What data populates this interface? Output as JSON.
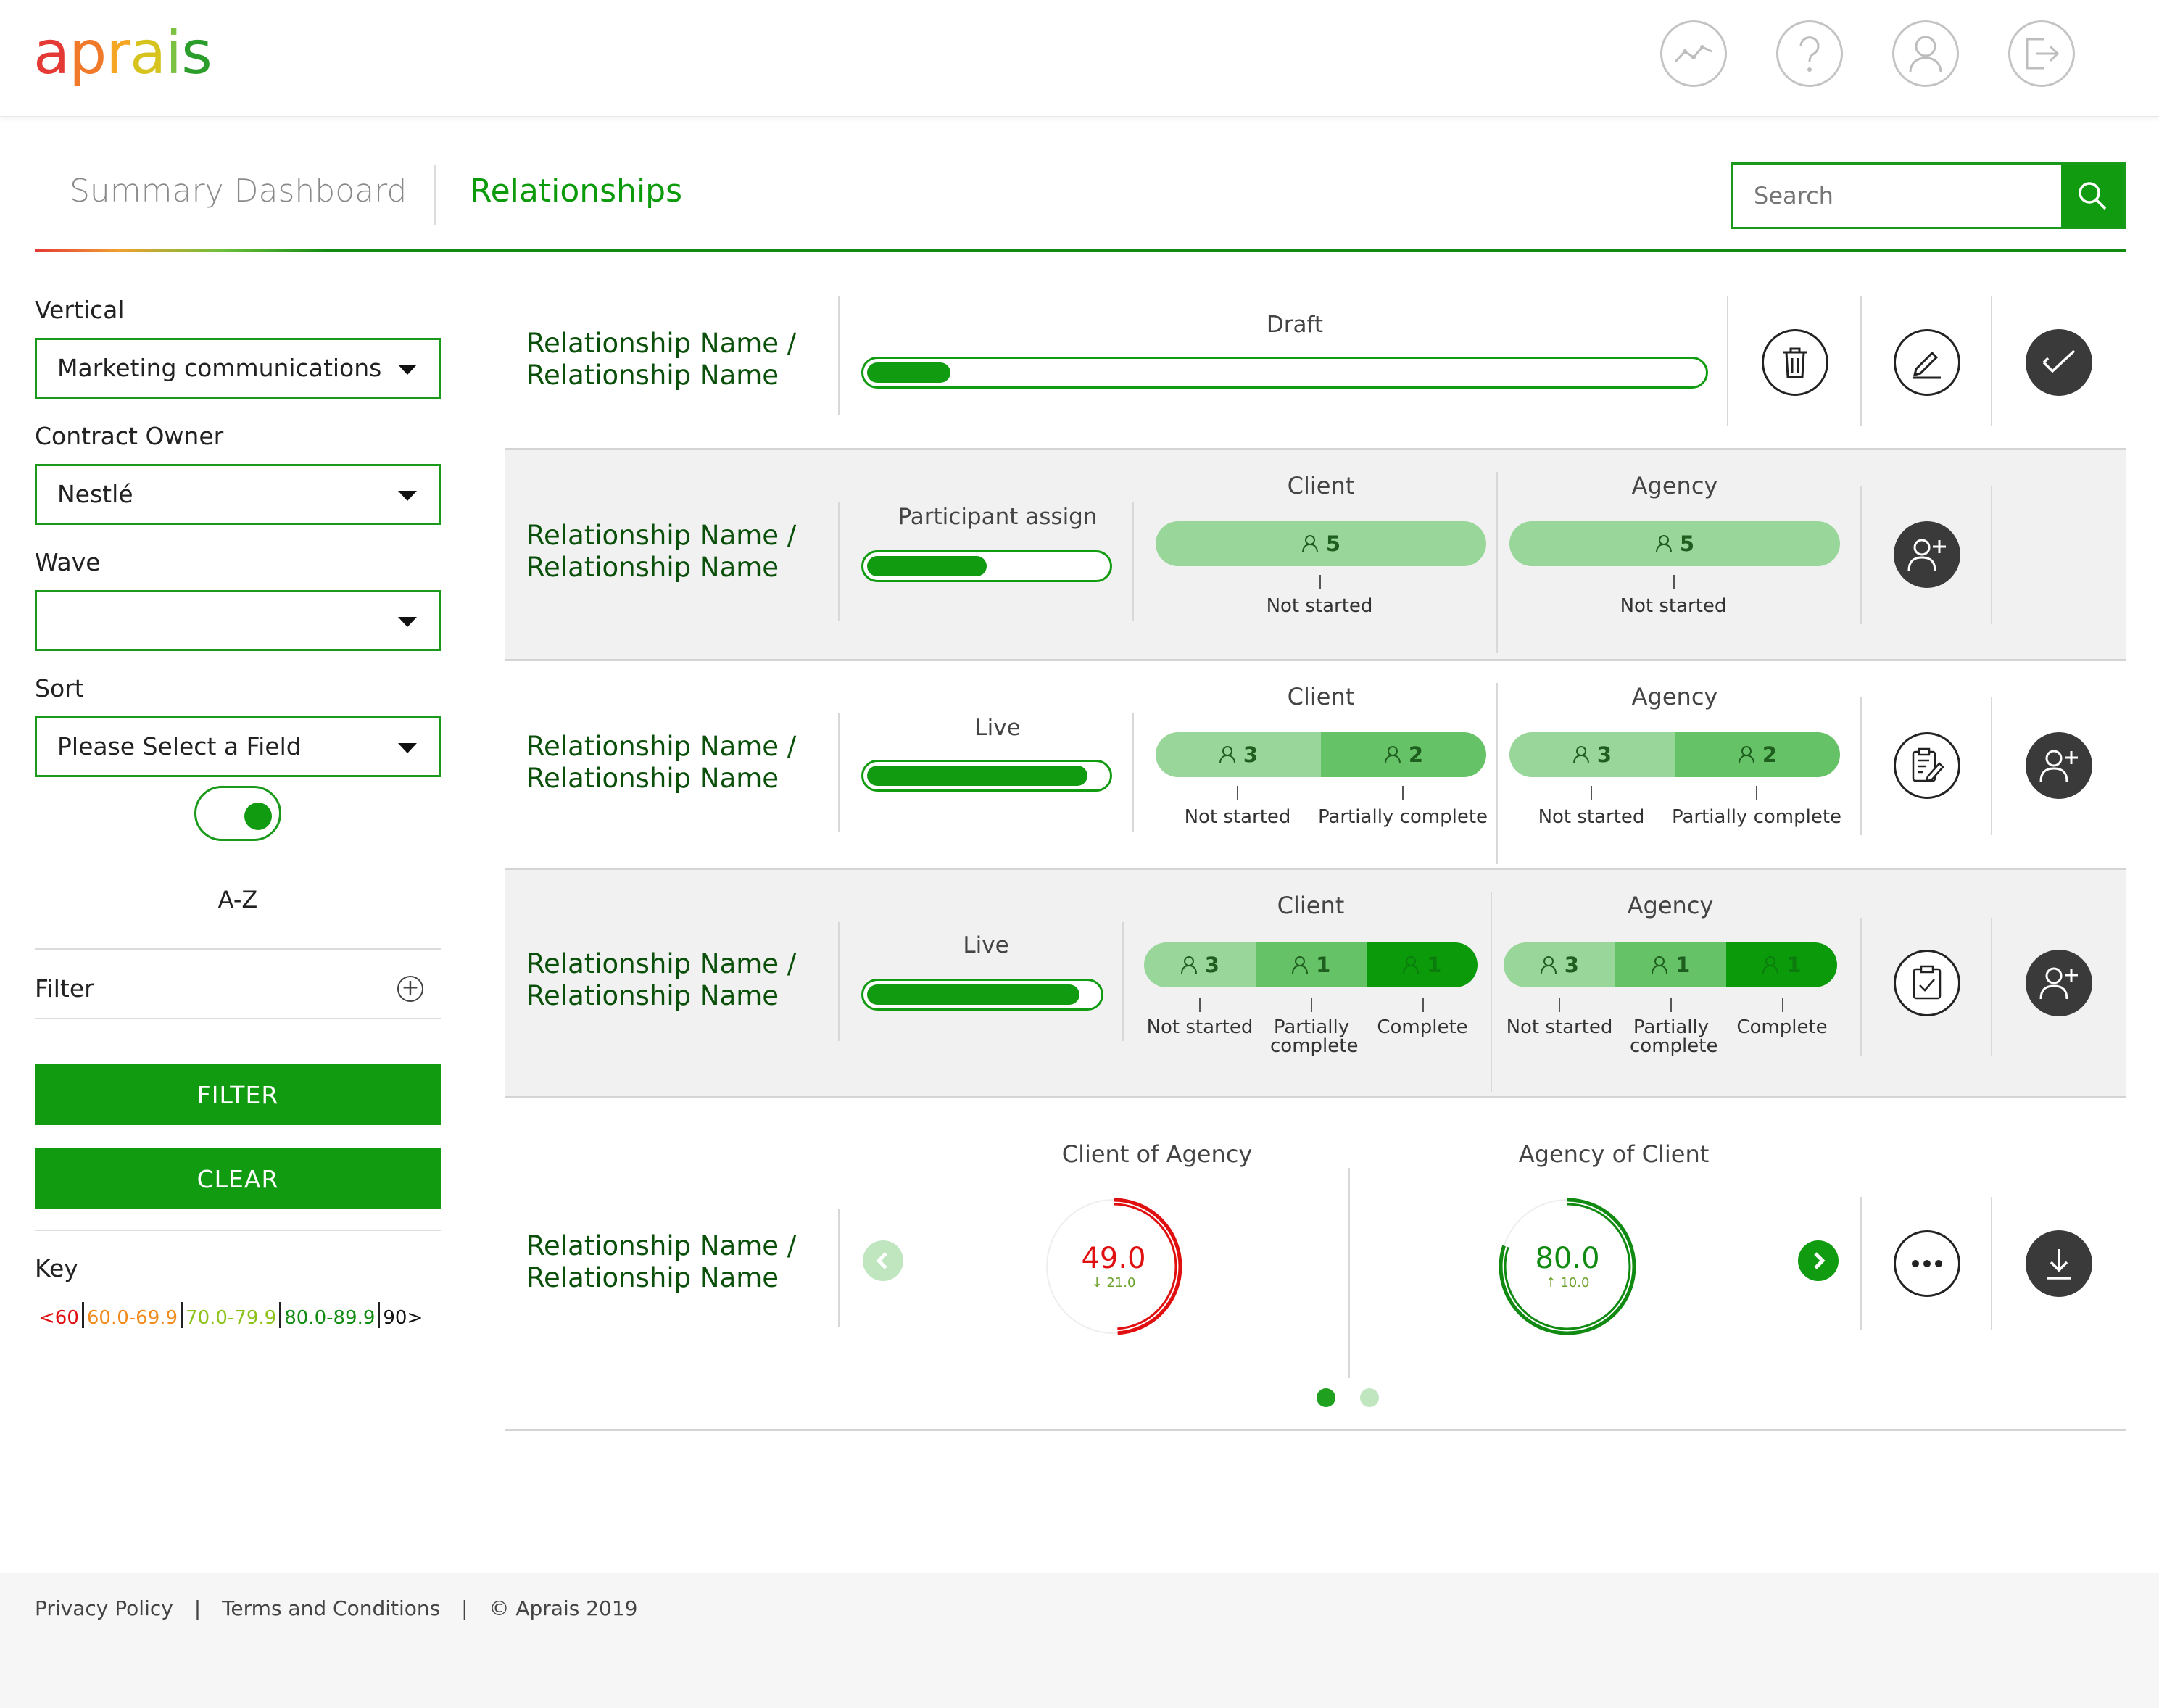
{
  "header": {
    "logo_letters": [
      {
        "ch": "a",
        "color": "#e53935"
      },
      {
        "ch": "p",
        "color": "#f07a2a"
      },
      {
        "ch": "r",
        "color": "#f5a623"
      },
      {
        "ch": "a",
        "color": "#d7c31e"
      },
      {
        "ch": "i",
        "color": "#7cc242"
      },
      {
        "ch": "s",
        "color": "#2a9d2a"
      }
    ],
    "icons": [
      "analytics-icon",
      "help-icon",
      "user-icon",
      "logout-icon"
    ]
  },
  "tabs": {
    "summary": "Summary Dashboard",
    "relationships": "Relationships"
  },
  "search": {
    "placeholder": "Search"
  },
  "sidebar": {
    "vertical_label": "Vertical",
    "vertical_value": "Marketing communications",
    "owner_label": "Contract Owner",
    "owner_value": "Nestlé",
    "wave_label": "Wave",
    "wave_value": "",
    "sort_label": "Sort",
    "sort_value": "Please Select a Field",
    "sort_order": "A-Z",
    "filter_label": "Filter",
    "filter_button": "FILTER",
    "clear_button": "CLEAR",
    "key_label": "Key",
    "key": [
      {
        "text": "<60",
        "color": "#e01010"
      },
      {
        "text": "60.0-69.9",
        "color": "#f08a1a"
      },
      {
        "text": "70.0-79.9",
        "color": "#8cc21a"
      },
      {
        "text": "80.0-89.9",
        "color": "#118a11"
      },
      {
        "text": "90>",
        "color": "#111111"
      }
    ]
  },
  "rows": [
    {
      "name_line1": "Relationship Name /",
      "name_line2": "Relationship Name",
      "status": "Draft",
      "progress": 0.1
    },
    {
      "name_line1": "Relationship Name /",
      "name_line2": "Relationship Name",
      "status": "Participant assign",
      "progress": 0.5,
      "client_title": "Client",
      "agency_title": "Agency",
      "client": [
        {
          "count": "5",
          "label": "Not started"
        }
      ],
      "agency": [
        {
          "count": "5",
          "label": "Not started"
        }
      ]
    },
    {
      "name_line1": "Relationship Name /",
      "name_line2": "Relationship Name",
      "status": "Live",
      "progress": 0.92,
      "client_title": "Client",
      "agency_title": "Agency",
      "client": [
        {
          "count": "3",
          "label": "Not started"
        },
        {
          "count": "2",
          "label": "Partially complete"
        }
      ],
      "agency": [
        {
          "count": "3",
          "label": "Not started"
        },
        {
          "count": "2",
          "label": "Partially complete"
        }
      ]
    },
    {
      "name_line1": "Relationship Name /",
      "name_line2": "Relationship Name",
      "status": "Live",
      "progress": 0.92,
      "client_title": "Client",
      "agency_title": "Agency",
      "client": [
        {
          "count": "3",
          "label": "Not started"
        },
        {
          "count": "1",
          "label": "Partially complete"
        },
        {
          "count": "1",
          "label": "Complete"
        }
      ],
      "agency": [
        {
          "count": "3",
          "label": "Not started"
        },
        {
          "count": "1",
          "label": "Partially complete"
        },
        {
          "count": "1",
          "label": "Complete"
        }
      ]
    },
    {
      "name_line1": "Relationship Name /",
      "name_line2": "Relationship Name",
      "client_of_agency_title": "Client of Agency",
      "client_of_agency_score": "49.0",
      "client_of_agency_change": "↓ 21.0",
      "client_of_agency_color": "#e01010",
      "agency_of_client_title": "Agency of Client",
      "agency_of_client_score": "80.0",
      "agency_of_client_change": "↑ 10.0",
      "agency_of_client_color": "#118a11",
      "client_of_agency_level": 0.49,
      "agency_of_client_level": 0.8
    }
  ],
  "footer": {
    "privacy": "Privacy Policy",
    "terms": "Terms and Conditions",
    "copyright": "© Aprais 2019",
    "sep": "|"
  }
}
